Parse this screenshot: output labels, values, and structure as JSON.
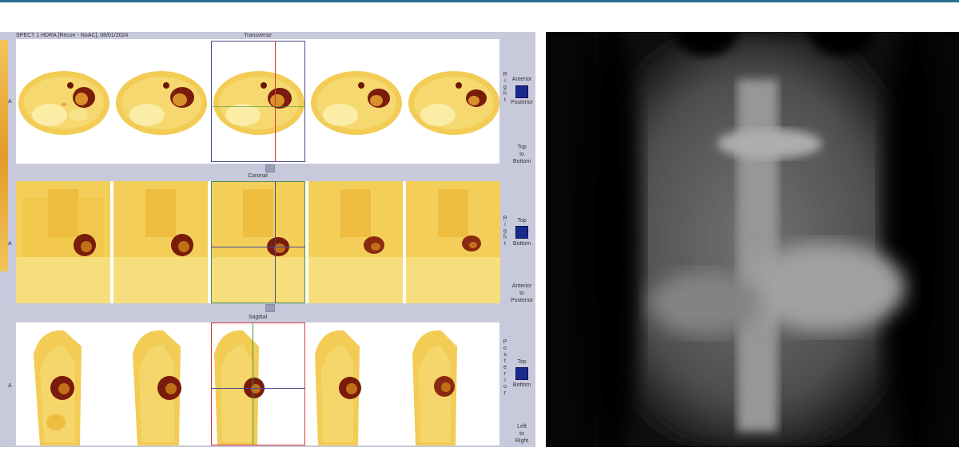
{
  "viewer": {
    "header": "SPECT 1 HDRA [Recon - NoAC], 08/01/2024",
    "row_letter": "A",
    "panels": [
      {
        "title": "Transverse",
        "side": "Right",
        "orient_top": "Anterior",
        "orient_bottom": "Posterior",
        "direction": "Top\nto\nBottom"
      },
      {
        "title": "Coronal",
        "side": "Right",
        "orient_top": "Top",
        "orient_bottom": "Bottom",
        "direction": "Anterior\nto\nPosterior"
      },
      {
        "title": "Sagittal",
        "side": "Posterior",
        "orient_top": "Top",
        "orient_bottom": "Bottom",
        "direction": "Left\nto\nRight"
      }
    ]
  },
  "colors": {
    "accent_bar": "#2a6f8f",
    "viewer_bg": "#c9c9dc",
    "selection_blue": "#4b4b8f",
    "selection_red": "#d23a3a",
    "selection_green": "#4a8f4a"
  }
}
